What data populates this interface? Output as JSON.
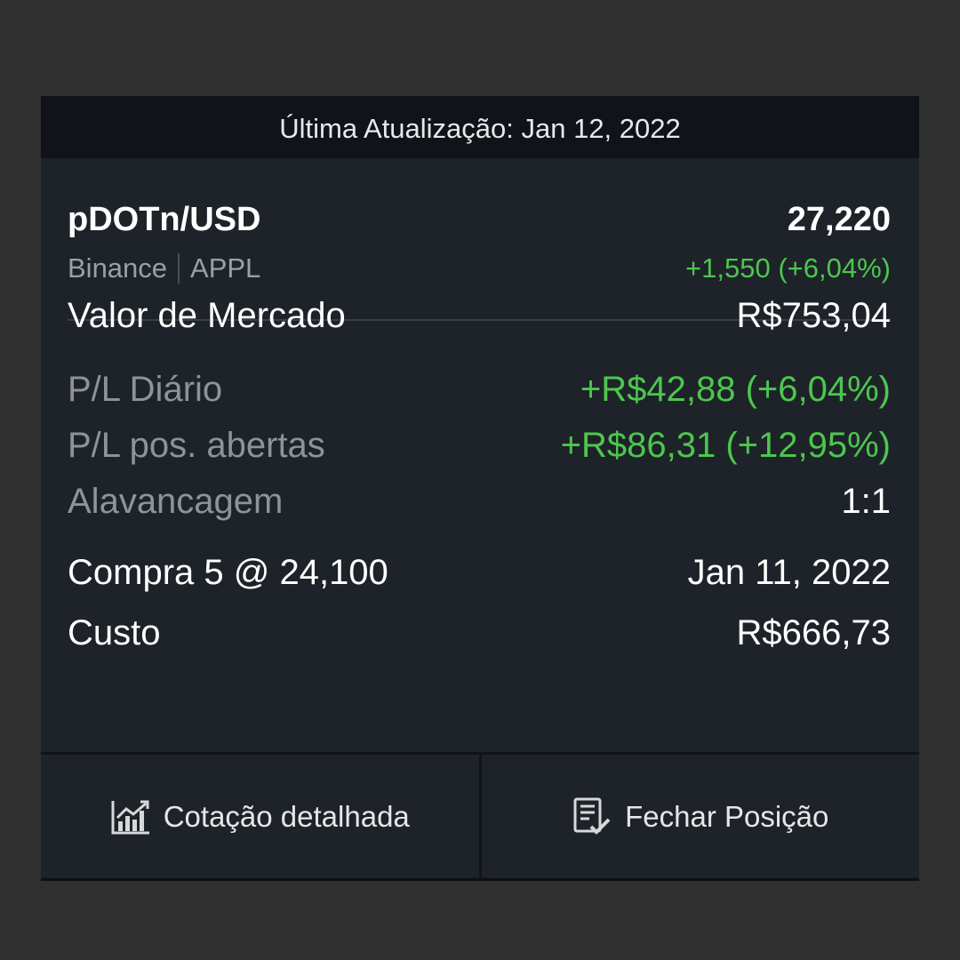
{
  "update_bar": {
    "text": "Última Atualização: Jan 12, 2022"
  },
  "header": {
    "symbol": "pDOTn/USD",
    "price": "27,220",
    "exchange": "Binance",
    "ticker": "APPL",
    "change": "+1,550 (+6,04%)"
  },
  "details": {
    "market_value_label": "Valor de Mercado",
    "market_value": "R$753,04",
    "daily_pl_label": "P/L Diário",
    "daily_pl": "+R$42,88 (+6,04%)",
    "open_pl_label": "P/L pos. abertas",
    "open_pl": "+R$86,31 (+12,95%)",
    "leverage_label": "Alavancagem",
    "leverage": "1:1",
    "trade_label": "Compra 5 @ 24,100",
    "trade_date": "Jan 11, 2022",
    "cost_label": "Custo",
    "cost": "R$666,73"
  },
  "footer": {
    "quote_label": "Cotação detalhada",
    "quote_icon": "chart-icon",
    "close_label": "Fechar Posição",
    "close_icon": "document-check-icon"
  },
  "colors": {
    "background": "#2f2f2f",
    "card": "#1e2329",
    "positive": "#4cc74e"
  }
}
